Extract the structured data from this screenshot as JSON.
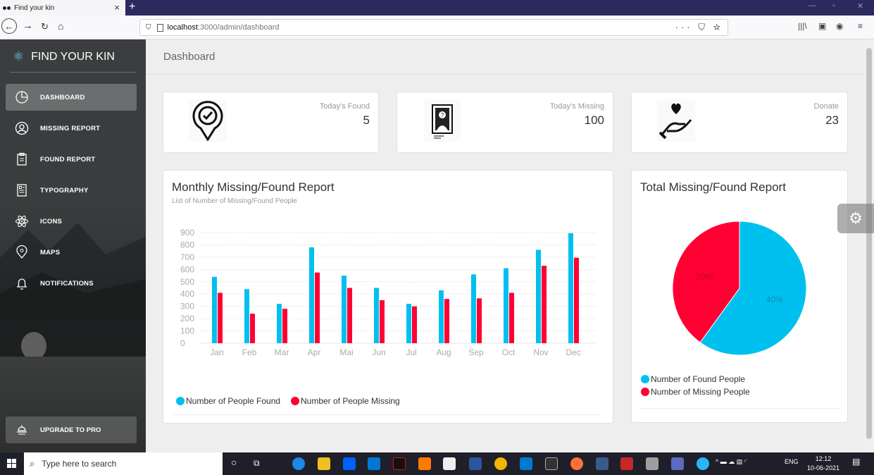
{
  "browser": {
    "tab_title": "Find your kin",
    "url_host": "localhost",
    "url_path": ":3000/admin/dashboard"
  },
  "sidebar": {
    "brand": "FIND YOUR KIN",
    "items": [
      {
        "label": "DASHBOARD",
        "icon": "pie-chart-icon",
        "active": true
      },
      {
        "label": "MISSING REPORT",
        "icon": "user-icon",
        "active": false
      },
      {
        "label": "FOUND REPORT",
        "icon": "clipboard-icon",
        "active": false
      },
      {
        "label": "TYPOGRAPHY",
        "icon": "document-icon",
        "active": false
      },
      {
        "label": "ICONS",
        "icon": "atom-icon",
        "active": false
      },
      {
        "label": "MAPS",
        "icon": "pin-icon",
        "active": false
      },
      {
        "label": "NOTIFICATIONS",
        "icon": "bell-icon",
        "active": false
      }
    ],
    "upgrade_label": "UPGRADE TO PRO"
  },
  "header": {
    "title": "Dashboard"
  },
  "stats": [
    {
      "label": "Today's Found",
      "value": "5",
      "icon": "found-badge-icon"
    },
    {
      "label": "Today's Missing",
      "value": "100",
      "icon": "missing-poster-icon"
    },
    {
      "label": "Donate",
      "value": "23",
      "icon": "heart-hand-icon"
    }
  ],
  "monthly": {
    "title": "Monthly Missing/Found Report",
    "subtitle": "List of Number of Missing/Found People",
    "legend": [
      "Number of People Found",
      "Number of People Missing"
    ]
  },
  "total": {
    "title": "Total Missing/Found Report",
    "legend": [
      "Number of Found People",
      "Number of Missing People"
    ]
  },
  "colors": {
    "found": "#00c0ef",
    "missing": "#ff0033"
  },
  "chart_data": [
    {
      "type": "bar",
      "categories": [
        "Jan",
        "Feb",
        "Mar",
        "Apr",
        "Mai",
        "Jun",
        "Jul",
        "Aug",
        "Sep",
        "Oct",
        "Nov",
        "Dec"
      ],
      "series": [
        {
          "name": "Number of People Found",
          "values": [
            540,
            440,
            320,
            780,
            550,
            450,
            320,
            430,
            560,
            610,
            760,
            895
          ]
        },
        {
          "name": "Number of People Missing",
          "values": [
            410,
            240,
            280,
            575,
            450,
            350,
            300,
            360,
            365,
            410,
            630,
            695
          ]
        }
      ],
      "yticks": [
        "900",
        "800",
        "700",
        "600",
        "500",
        "400",
        "300",
        "200",
        "100",
        "0"
      ],
      "ylim": [
        0,
        900
      ],
      "grid": true,
      "legend": "bottom-left"
    },
    {
      "type": "pie",
      "labels": [
        "Number of Found People",
        "Number of Missing People"
      ],
      "values": [
        60,
        40
      ],
      "data_labels": [
        "40%",
        "20%"
      ],
      "legend": "bottom-left"
    }
  ],
  "taskbar": {
    "search_placeholder": "Type here to search",
    "time": "12:12",
    "date": "10-06-2021",
    "lang": "ENG"
  }
}
